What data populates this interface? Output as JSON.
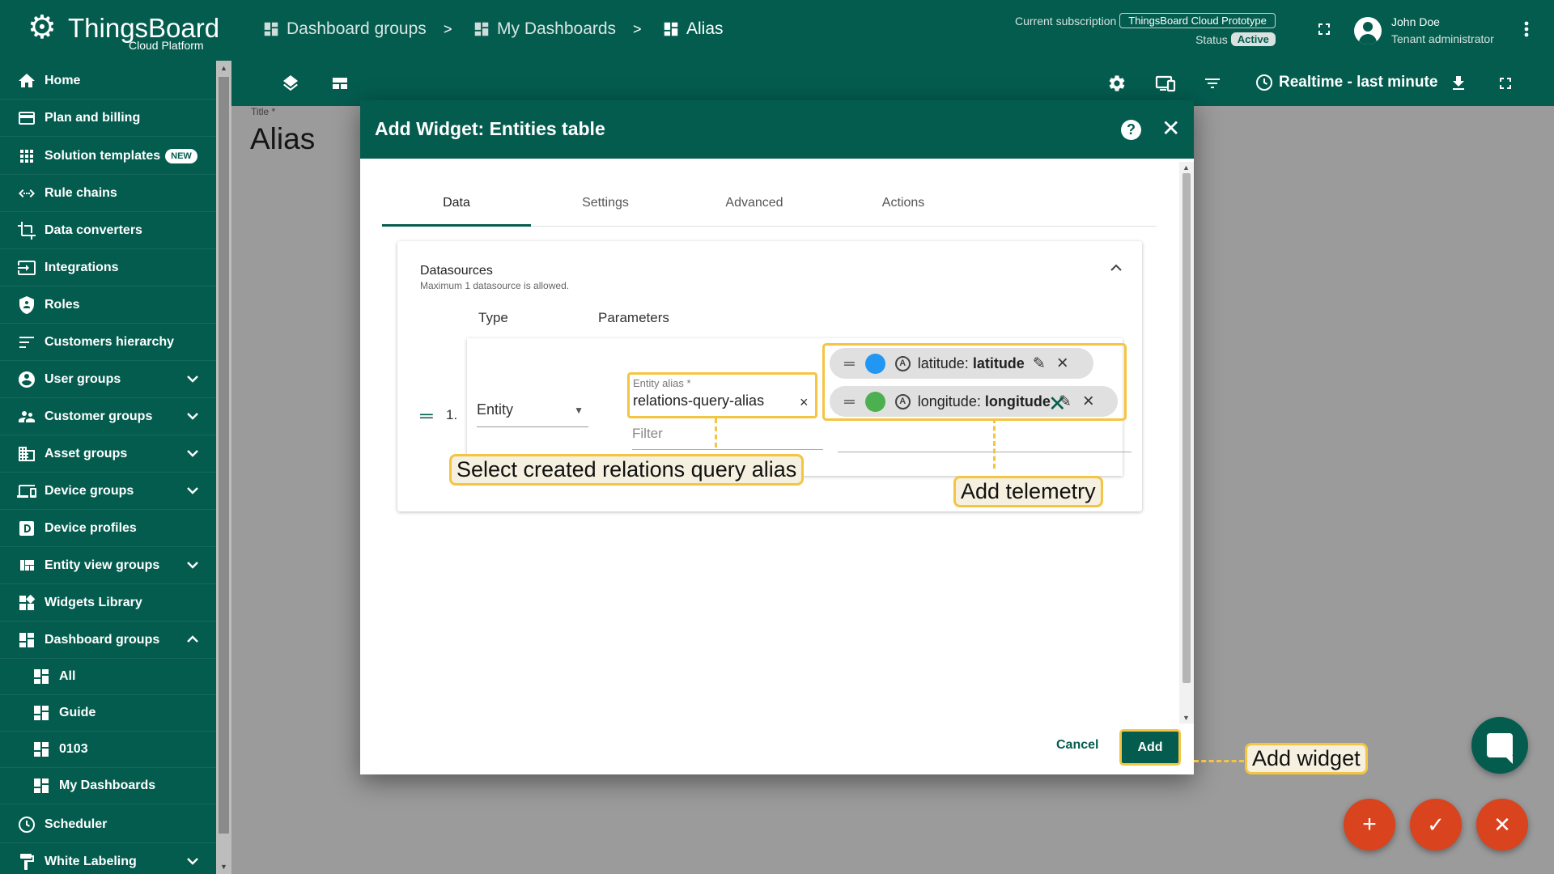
{
  "app": {
    "logo_name": "ThingsBoard",
    "logo_sub": "Cloud Platform"
  },
  "sidebar": {
    "items": [
      {
        "label": "Home",
        "icon": "home-icon"
      },
      {
        "label": "Plan and billing",
        "icon": "billing-icon"
      },
      {
        "label": "Solution templates",
        "icon": "apps-icon",
        "badge": "NEW"
      },
      {
        "label": "Rule chains",
        "icon": "rule-chains-icon"
      },
      {
        "label": "Data converters",
        "icon": "converter-icon"
      },
      {
        "label": "Integrations",
        "icon": "integrations-icon"
      },
      {
        "label": "Roles",
        "icon": "shield-icon"
      },
      {
        "label": "Customers hierarchy",
        "icon": "hierarchy-icon"
      },
      {
        "label": "User groups",
        "icon": "account-icon",
        "expandable": true
      },
      {
        "label": "Customer groups",
        "icon": "supervisor-icon",
        "expandable": true
      },
      {
        "label": "Asset groups",
        "icon": "domain-icon",
        "expandable": true
      },
      {
        "label": "Device groups",
        "icon": "devices-icon",
        "expandable": true
      },
      {
        "label": "Device profiles",
        "icon": "device-profile-icon"
      },
      {
        "label": "Entity view groups",
        "icon": "view-quilt-icon",
        "expandable": true
      },
      {
        "label": "Widgets Library",
        "icon": "widgets-icon"
      },
      {
        "label": "Dashboard groups",
        "icon": "dashboard-icon",
        "expanded": true
      },
      {
        "label": "All",
        "icon": "dashboard-icon",
        "sub": true
      },
      {
        "label": "Guide",
        "icon": "dashboard-icon",
        "sub": true
      },
      {
        "label": "0103",
        "icon": "dashboard-icon",
        "sub": true
      },
      {
        "label": "My Dashboards",
        "icon": "dashboard-icon",
        "sub": true
      },
      {
        "label": "Scheduler",
        "icon": "schedule-icon"
      },
      {
        "label": "White Labeling",
        "icon": "format-paint-icon",
        "expandable": true
      }
    ]
  },
  "header": {
    "breadcrumbs": [
      "Dashboard groups",
      "My Dashboards",
      "Alias"
    ],
    "breadcrumb_separator": ">",
    "subscription_label": "Current subscription",
    "subscription_value": "ThingsBoard Cloud Prototype",
    "status_label": "Status",
    "status_value": "Active",
    "user_name": "John Doe",
    "user_role": "Tenant administrator"
  },
  "toolbar": {
    "timewindow": "Realtime - last minute"
  },
  "dashboard": {
    "title_label": "Title *",
    "title_value": "Alias"
  },
  "dialog": {
    "title": "Add Widget: Entities table",
    "help": "?",
    "tabs": [
      "Data",
      "Settings",
      "Advanced",
      "Actions"
    ],
    "active_tab": "Data",
    "datasources": {
      "title": "Datasources",
      "subtitle": "Maximum 1 datasource is allowed.",
      "col_type": "Type",
      "col_parameters": "Parameters",
      "row_number": "1.",
      "type_value": "Entity",
      "alias_label": "Entity alias *",
      "alias_value": "relations-query-alias",
      "filter_placeholder": "Filter",
      "keys": [
        {
          "label": "latitude: ",
          "bold": "latitude",
          "color": "#2196f3"
        },
        {
          "label": "longitude: ",
          "bold": "longitude",
          "color": "#4caf50"
        }
      ]
    },
    "cancel_label": "Cancel",
    "add_label": "Add"
  },
  "callouts": {
    "alias": "Select created relations query alias",
    "telemetry": "Add telemetry",
    "add_widget": "Add widget"
  },
  "colors": {
    "primary": "#045c4f",
    "accent": "#d9431e",
    "highlight": "#f4c542"
  }
}
